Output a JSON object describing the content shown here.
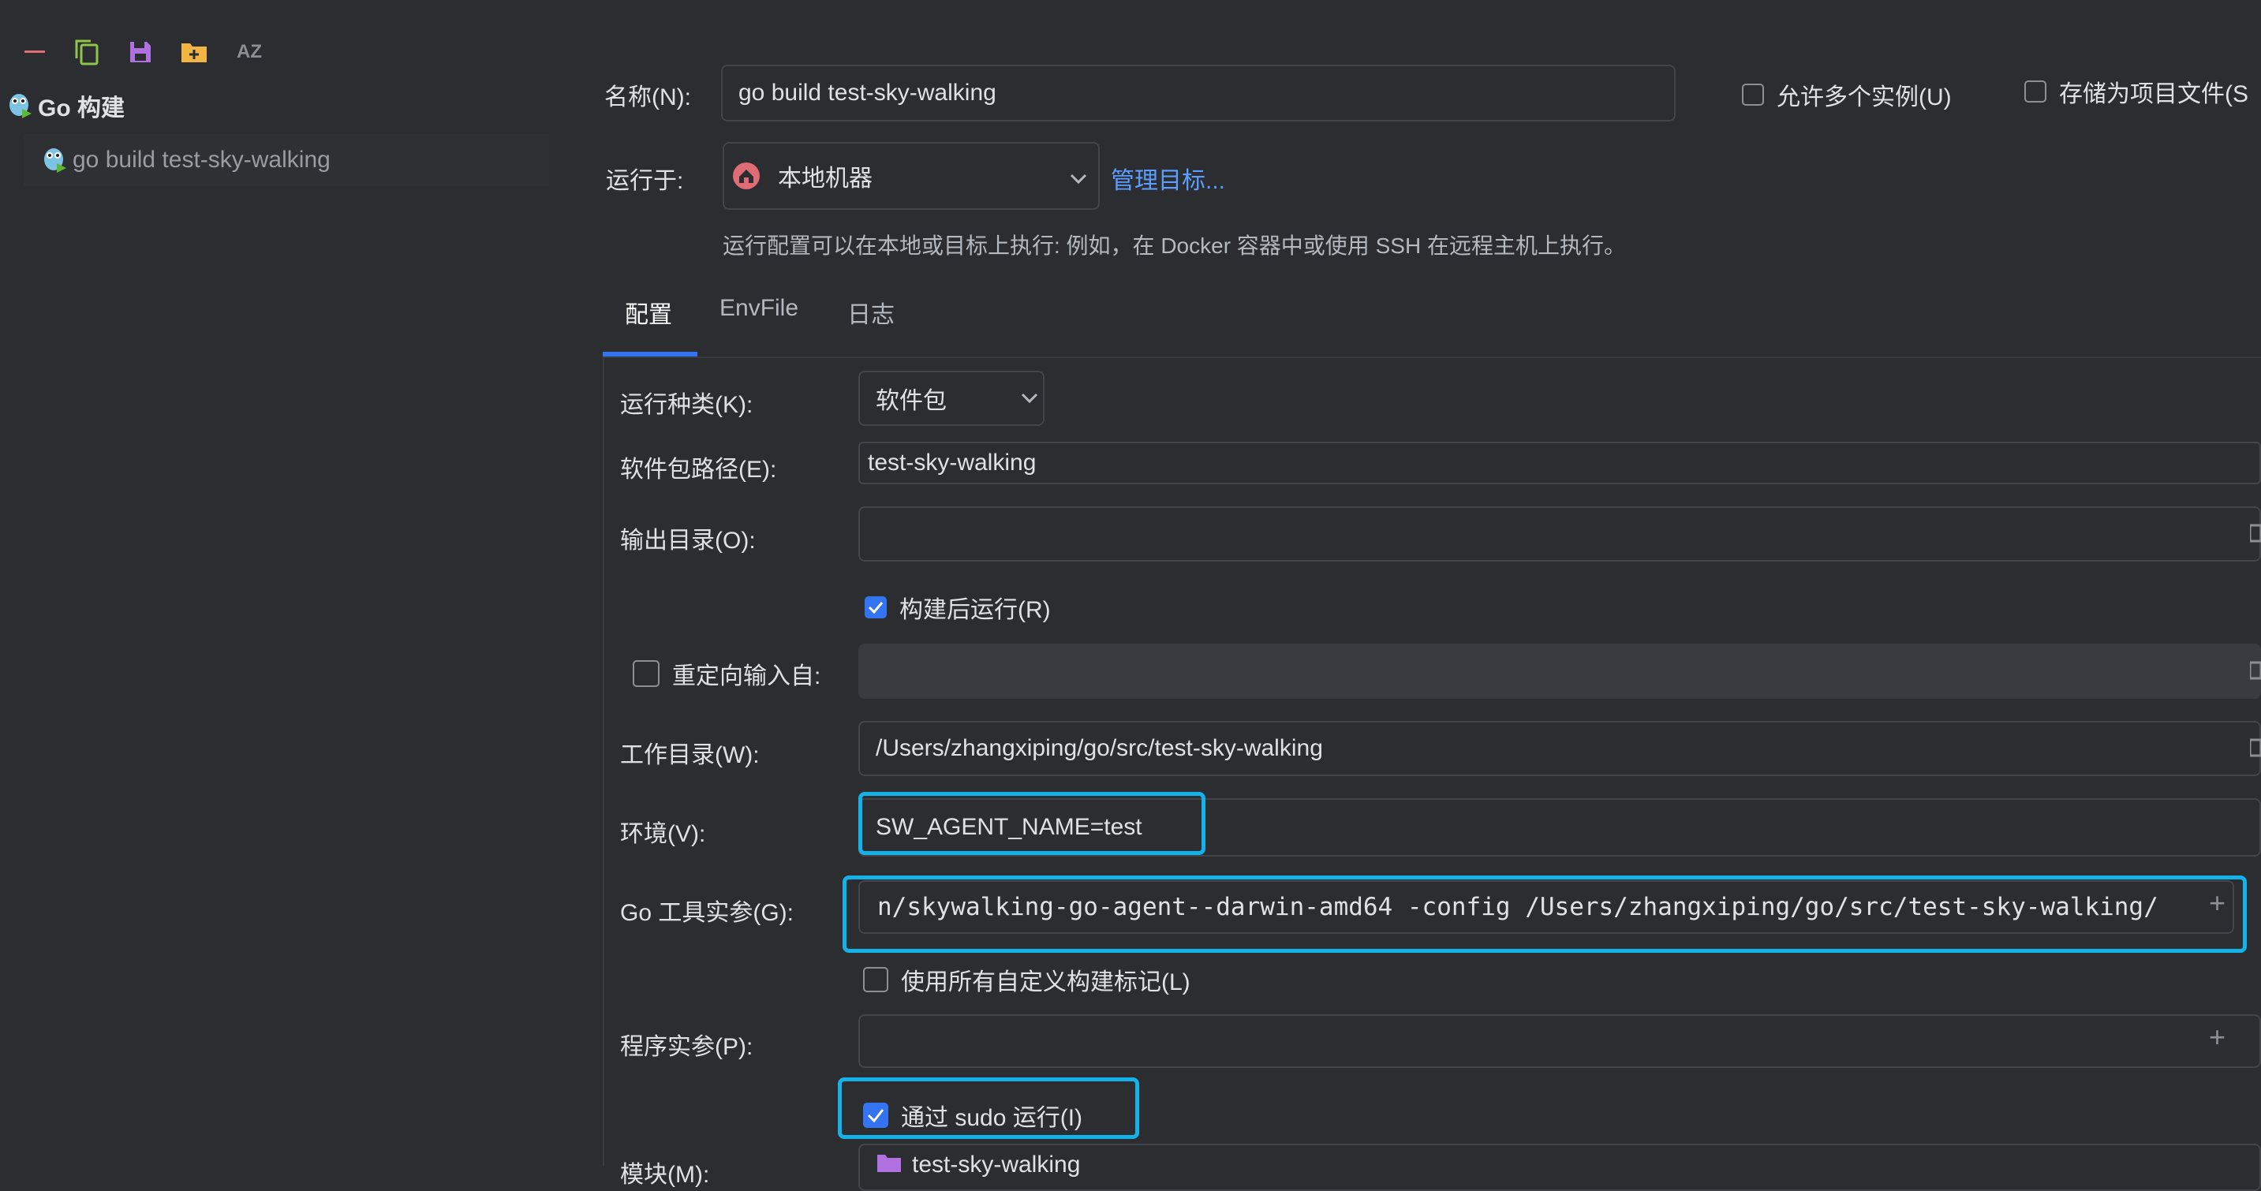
{
  "toolbar": {
    "items": [
      {
        "name": "remove-icon",
        "color": "#e06c75"
      },
      {
        "name": "copy-icon",
        "color": "#8fc34a"
      },
      {
        "name": "save-icon",
        "color": "#b070e0"
      },
      {
        "name": "new-folder-icon",
        "color": "#f2b443"
      },
      {
        "name": "sort-alphabetically-icon",
        "color": "#8c8f94"
      }
    ],
    "sort_label": "AZ"
  },
  "tree": {
    "group_label": "Go 构建",
    "item_label": "go build test-sky-walking"
  },
  "header": {
    "name_label": "名称(N):",
    "name_value": "go build test-sky-walking",
    "allow_multiple_label": "允许多个实例(U)",
    "store_as_project_label": "存储为项目文件(S",
    "run_on_label": "运行于:",
    "run_on_value": "本地机器",
    "manage_targets_label": "管理目标...",
    "hint": "运行配置可以在本地或目标上执行: 例如，在 Docker 容器中或使用 SSH 在远程主机上执行。"
  },
  "tabs": [
    {
      "label": "配置",
      "active": true
    },
    {
      "label": "EnvFile",
      "active": false
    },
    {
      "label": "日志",
      "active": false
    }
  ],
  "form": {
    "run_kind_label": "运行种类(K):",
    "run_kind_value": "软件包",
    "package_path_label": "软件包路径(E):",
    "package_path_value": "test-sky-walking",
    "output_dir_label": "输出目录(O):",
    "output_dir_value": "",
    "run_after_build_label": "构建后运行(R)",
    "run_after_build_checked": true,
    "redirect_input_label": "重定向输入自:",
    "redirect_input_checked": false,
    "working_dir_label": "工作目录(W):",
    "working_dir_value": "/Users/zhangxiping/go/src/test-sky-walking",
    "env_label": "环境(V):",
    "env_value": "SW_AGENT_NAME=test",
    "go_tool_args_label": "Go 工具实参(G):",
    "go_tool_args_value": "n/skywalking-go-agent--darwin-amd64 -config /Users/zhangxiping/go/src/test-sky-walking/",
    "use_all_tags_label": "使用所有自定义构建标记(L)",
    "use_all_tags_checked": false,
    "program_args_label": "程序实参(P):",
    "program_args_value": "",
    "run_with_sudo_label": "通过 sudo 运行(I)",
    "run_with_sudo_checked": true,
    "module_label": "模块(M):",
    "module_value": "test-sky-walking"
  },
  "colors": {
    "background": "#2b2d30",
    "accent": "#3574f0",
    "highlight": "#13b3ea",
    "link": "#5c9eff"
  }
}
